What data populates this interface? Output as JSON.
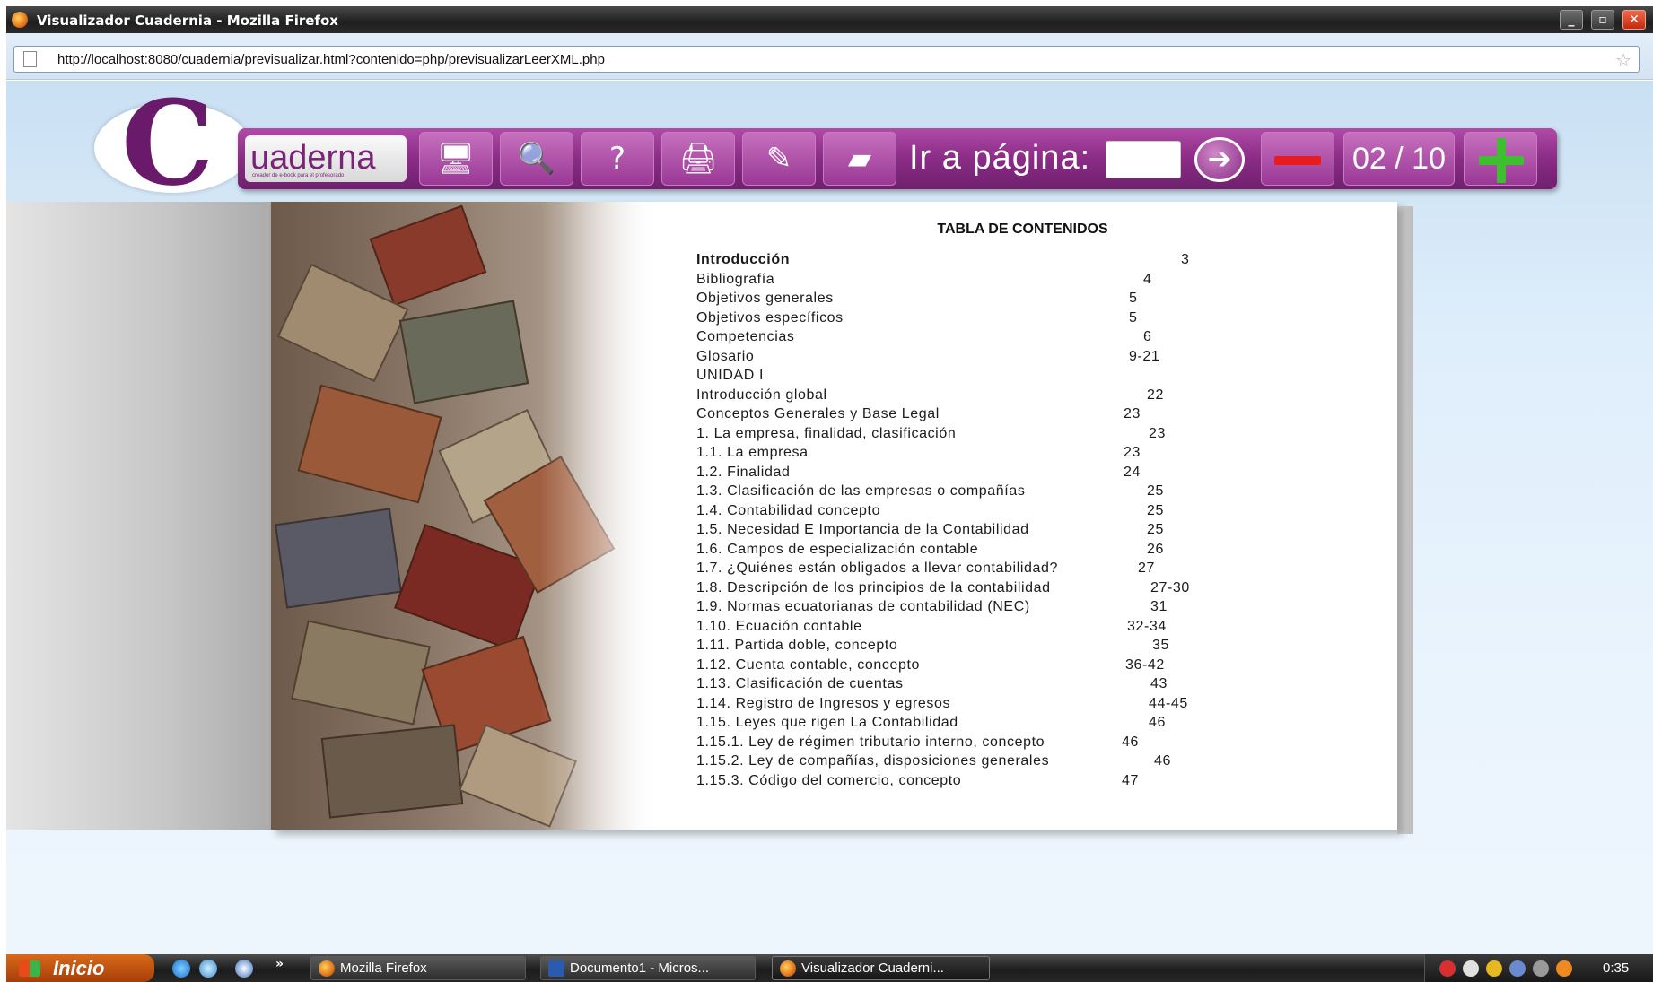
{
  "window": {
    "title": "Visualizador Cuadernia - Mozilla Firefox",
    "url": "http://localhost:8080/cuadernia/previsualizar.html?contenido=php/previsualizarLeerXML.php",
    "min": "_",
    "max": "▫",
    "close": "✕"
  },
  "app": {
    "brand": "uaderna",
    "brand_tagline": "creador de e-book para el profesorado",
    "goto_label": "Ir a página:",
    "goto_value": "",
    "page_counter": "02 / 10",
    "icons": [
      "screen-icon",
      "zoom-icon",
      "help-icon",
      "print-icon",
      "edit-icon",
      "eraser-icon",
      "go-arrow-icon",
      "minus-icon",
      "plus-icon"
    ]
  },
  "toc": {
    "title": "TABLA DE CONTENIDOS",
    "entries": [
      {
        "label": "Introducción",
        "page": "3"
      },
      {
        "label": "Bibliografía",
        "page": "4"
      },
      {
        "label": "Objetivos generales",
        "page": "5"
      },
      {
        "label": "Objetivos específicos",
        "page": "5"
      },
      {
        "label": "Competencias",
        "page": "6"
      },
      {
        "label": "Glosario",
        "page": "9-21"
      },
      {
        "label": "UNIDAD I",
        "page": ""
      },
      {
        "label": "Introducción global",
        "page": "22"
      },
      {
        "label": "Conceptos Generales y Base Legal",
        "page": "23"
      },
      {
        "label": "1. La empresa, finalidad, clasificación",
        "page": "23"
      },
      {
        "label": "1.1. La empresa",
        "page": "23"
      },
      {
        "label": "1.2. Finalidad",
        "page": "24"
      },
      {
        "label": "1.3. Clasificación de las empresas o compañías",
        "page": "25"
      },
      {
        "label": "1.4. Contabilidad concepto",
        "page": "25"
      },
      {
        "label": "1.5. Necesidad E Importancia de la Contabilidad",
        "page": "25"
      },
      {
        "label": "1.6. Campos de especialización contable",
        "page": "26"
      },
      {
        "label": "1.7. ¿Quiénes están obligados a llevar contabilidad?",
        "page": "27"
      },
      {
        "label": "1.8. Descripción de los principios de la contabilidad",
        "page": "27-30"
      },
      {
        "label": "1.9. Normas ecuatorianas de contabilidad (NEC)",
        "page": "31"
      },
      {
        "label": "1.10. Ecuación contable",
        "page": "32-34"
      },
      {
        "label": "1.11. Partida doble, concepto",
        "page": "35"
      },
      {
        "label": "1.12. Cuenta contable, concepto",
        "page": "36-42"
      },
      {
        "label": "1.13. Clasificación de cuentas",
        "page": "43"
      },
      {
        "label": "1.14. Registro de Ingresos y egresos",
        "page": "44-45"
      },
      {
        "label": "1.15. Leyes que rigen La Contabilidad",
        "page": "46"
      },
      {
        "label": "1.15.1. Ley de régimen tributario interno, concepto",
        "page": "46"
      },
      {
        "label": "1.15.2. Ley de compañías, disposiciones generales",
        "page": "46"
      },
      {
        "label": "1.15.3. Código del comercio, concepto",
        "page": "47"
      }
    ]
  },
  "taskbar": {
    "start": "Inicio",
    "more": "»",
    "tasks": [
      "Mozilla Firefox",
      "Documento1 - Micros...",
      "Visualizador Cuaderni..."
    ],
    "clock": "0:35"
  }
}
